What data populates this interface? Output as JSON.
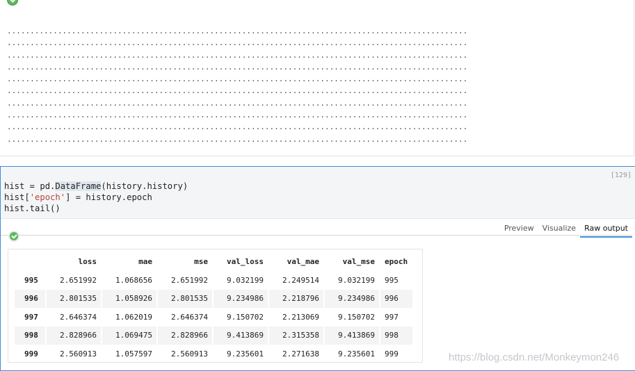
{
  "top_cell": {
    "progress_lines": [
      "....................................................................................................",
      "....................................................................................................",
      "....................................................................................................",
      "....................................................................................................",
      "....................................................................................................",
      "....................................................................................................",
      "....................................................................................................",
      "....................................................................................................",
      "....................................................................................................",
      "...................................................................................................."
    ]
  },
  "code_cell": {
    "execution_count": "[129]",
    "lines": {
      "l1a": "hist = pd.",
      "l1b": "DataFrame",
      "l1c": "(history.history)",
      "l2a": "hist[",
      "l2b": "'epoch'",
      "l2c": "] = history.epoch",
      "l3": "hist.tail()"
    }
  },
  "output_tabs": [
    {
      "label": "Preview"
    },
    {
      "label": "Visualize"
    },
    {
      "label": "Raw output"
    }
  ],
  "dataframe": {
    "columns": [
      "loss",
      "mae",
      "mse",
      "val_loss",
      "val_mae",
      "val_mse",
      "epoch"
    ],
    "rows": [
      {
        "index": "995",
        "values": [
          "2.651992",
          "1.068656",
          "2.651992",
          "9.032199",
          "2.249514",
          "9.032199",
          "995"
        ]
      },
      {
        "index": "996",
        "values": [
          "2.801535",
          "1.058926",
          "2.801535",
          "9.234986",
          "2.218796",
          "9.234986",
          "996"
        ]
      },
      {
        "index": "997",
        "values": [
          "2.646374",
          "1.062019",
          "2.646374",
          "9.150702",
          "2.213069",
          "9.150702",
          "997"
        ]
      },
      {
        "index": "998",
        "values": [
          "2.828966",
          "1.069475",
          "2.828966",
          "9.413869",
          "2.315358",
          "9.413869",
          "998"
        ]
      },
      {
        "index": "999",
        "values": [
          "2.560913",
          "1.057597",
          "2.560913",
          "9.235601",
          "2.271638",
          "9.235601",
          "999"
        ]
      }
    ]
  },
  "watermark": "https://blog.csdn.net/Monkeymon246"
}
